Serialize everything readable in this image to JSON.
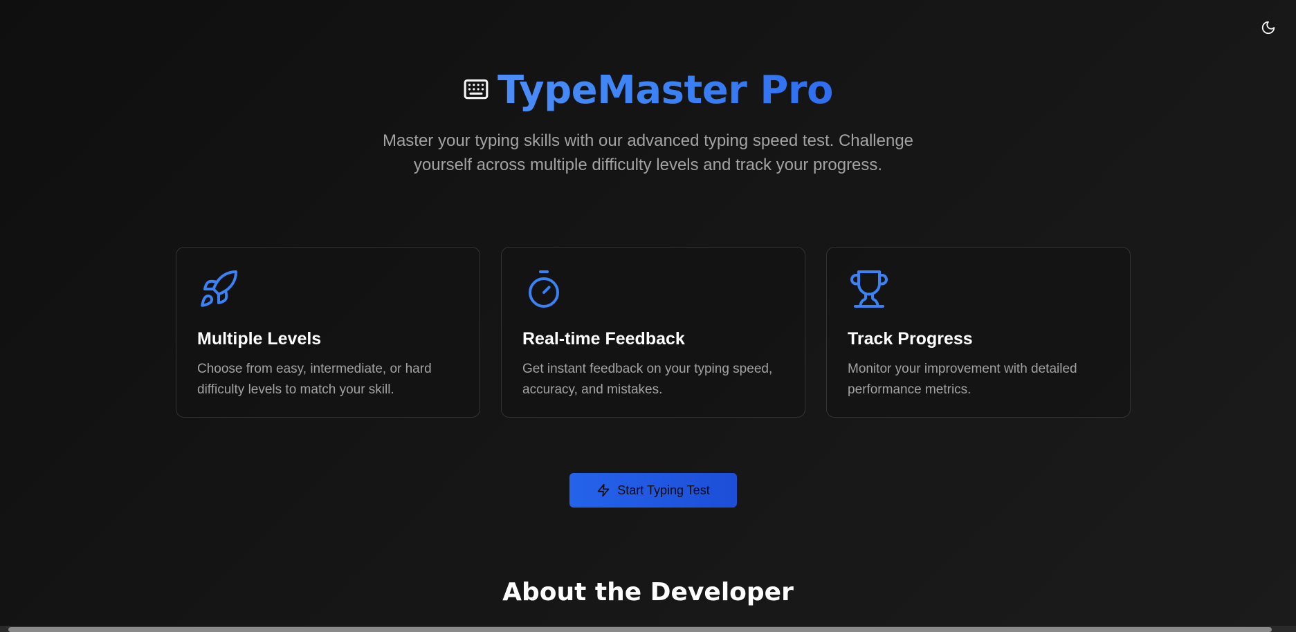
{
  "header": {
    "theme_toggle_icon": "moon-icon"
  },
  "hero": {
    "logo_icon": "keyboard-icon",
    "title": "TypeMaster Pro",
    "subtitle": "Master your typing skills with our advanced typing speed test. Challenge yourself across multiple difficulty levels and track your progress."
  },
  "features": [
    {
      "icon": "rocket-icon",
      "title": "Multiple Levels",
      "description": "Choose from easy, intermediate, or hard difficulty levels to match your skill."
    },
    {
      "icon": "stopwatch-icon",
      "title": "Real-time Feedback",
      "description": "Get instant feedback on your typing speed, accuracy, and mistakes."
    },
    {
      "icon": "trophy-icon",
      "title": "Track Progress",
      "description": "Monitor your improvement with detailed performance metrics."
    }
  ],
  "cta": {
    "icon": "lightning-icon",
    "label": "Start Typing Test"
  },
  "about": {
    "heading": "About the Developer"
  },
  "colors": {
    "accent": "#3b82f6",
    "background": "#141414",
    "muted_text": "#a3a3a3",
    "card_border": "#333333"
  }
}
